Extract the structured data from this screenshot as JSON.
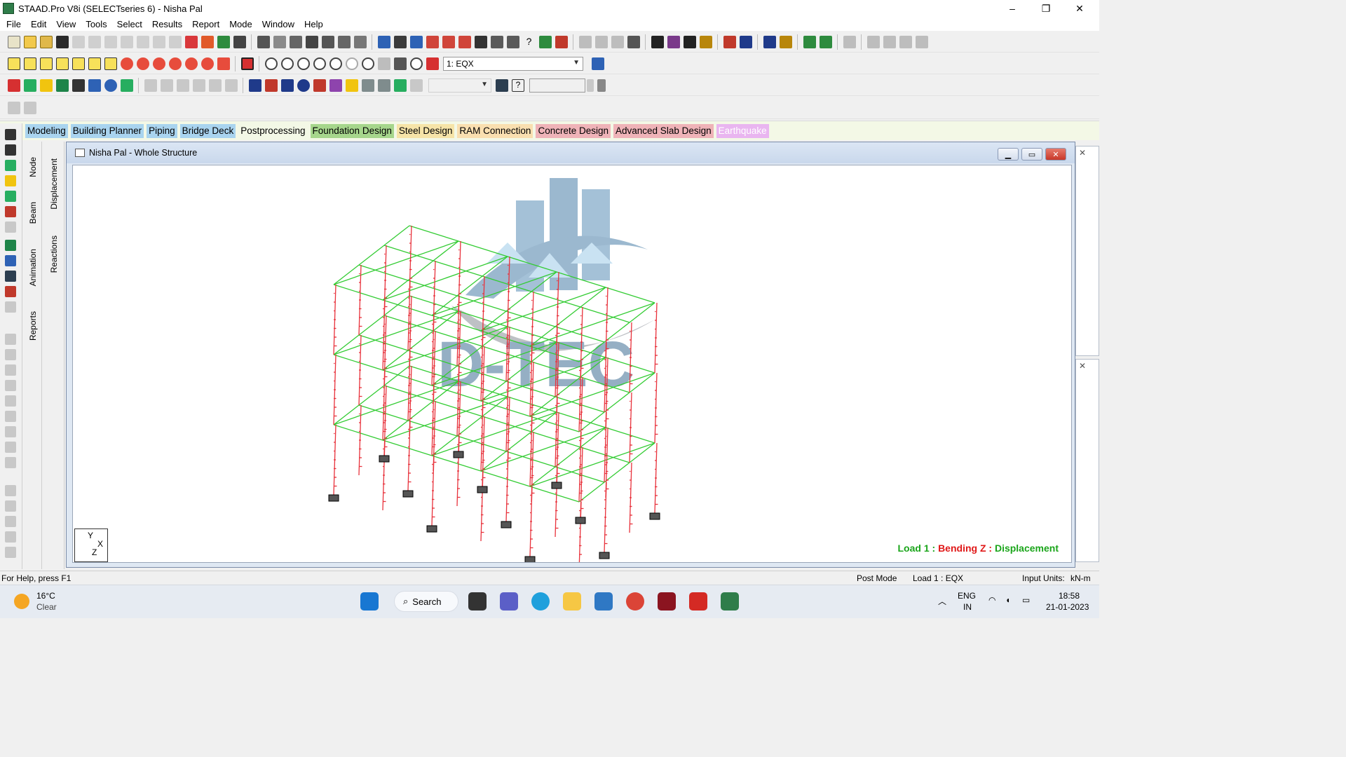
{
  "window": {
    "title": "STAAD.Pro V8i (SELECTseries 6) - Nisha Pal",
    "min": "–",
    "max": "❐",
    "close": "✕"
  },
  "menu": [
    "File",
    "Edit",
    "View",
    "Tools",
    "Select",
    "Results",
    "Report",
    "Mode",
    "Window",
    "Help"
  ],
  "toolbar2": {
    "load_case": "1: EQX"
  },
  "workflow_tabs": [
    {
      "label": "Modeling",
      "color": "#a9d4ef",
      "text": "#000000"
    },
    {
      "label": "Building Planner",
      "color": "#a9d4ef",
      "text": "#000000"
    },
    {
      "label": "Piping",
      "color": "#a9d4ef",
      "text": "#000000"
    },
    {
      "label": "Bridge Deck",
      "color": "#a9d4ef",
      "text": "#000000"
    },
    {
      "label": "Postprocessing",
      "color": "#f3f8e6",
      "text": "#000000"
    },
    {
      "label": "Foundation Design",
      "color": "#a6d68c",
      "text": "#000000"
    },
    {
      "label": "Steel Design",
      "color": "#f6e4a8",
      "text": "#000000"
    },
    {
      "label": "RAM Connection",
      "color": "#f9dfb0",
      "text": "#000000"
    },
    {
      "label": "Concrete Design",
      "color": "#efb3b8",
      "text": "#000000"
    },
    {
      "label": "Advanced Slab Design",
      "color": "#efb3b8",
      "text": "#000000"
    },
    {
      "label": "Earthquake",
      "color": "#e9b5f0",
      "text": "#ffffff"
    }
  ],
  "left_vtabs": {
    "node": "Node",
    "beam": "Beam",
    "animation": "Animation",
    "reports": "Reports"
  },
  "right_vtabs": {
    "displacement": "Displacement",
    "reactions": "Reactions"
  },
  "view": {
    "title": "Nisha Pal - Whole Structure",
    "axis_y": "Y",
    "axis_x": "X",
    "axis_z": "Z",
    "legend": {
      "load": "Load 1 : ",
      "force": "Bending Z : ",
      "result": "Displacement"
    },
    "watermark": "D-TEC"
  },
  "status": {
    "help": "For Help, press F1",
    "mode": "Post Mode",
    "load": "Load 1 : EQX",
    "units_label": "Input Units:",
    "units": "kN-m"
  },
  "taskbar": {
    "weather_temp": "16°C",
    "weather_cond": "Clear",
    "search": "Search",
    "lang": "ENG",
    "region": "IN",
    "time": "18:58",
    "date": "21-01-2023"
  },
  "colors": {
    "legend_green": "#1aa51a",
    "legend_red": "#e01818",
    "member_green": "#33cc33",
    "member_red": "#e8323c"
  }
}
